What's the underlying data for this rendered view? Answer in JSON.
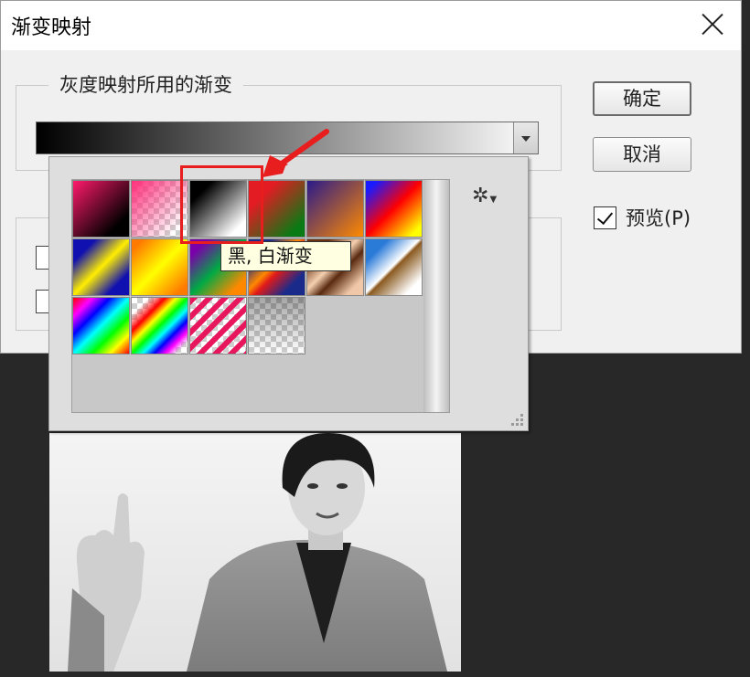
{
  "dialog": {
    "title": "渐变映射",
    "group_label": "灰度映射所用的渐变",
    "ok_label": "确定",
    "cancel_label": "取消",
    "preview_label": "预览(P)",
    "preview_checked": true
  },
  "gradient_picker": {
    "current_gradient": "黑, 白渐变",
    "swatches": [
      "magenta-black",
      "pink-transparent",
      "black-white",
      "red-green",
      "violet-orange",
      "blue-red-yellow",
      "blue-yellow-blue",
      "orange-yellow-orange",
      "violet-green-orange",
      "steel-bar",
      "copper",
      "chrome",
      "spectrum",
      "transparent-rainbow",
      "transparent-stripes",
      "neutral-density"
    ],
    "tooltip": "黑, 白渐变",
    "selected_index": 2
  },
  "colors": {
    "highlight": "#e81e1e",
    "tooltip_bg": "#ffffe1",
    "dialog_bg": "#f0f0f0",
    "canvas_bg": "#282828"
  },
  "icons": {
    "close": "close-icon",
    "settings": "gear-icon",
    "dropdown": "chevron-down-icon",
    "checkbox": "checkmark-icon"
  }
}
